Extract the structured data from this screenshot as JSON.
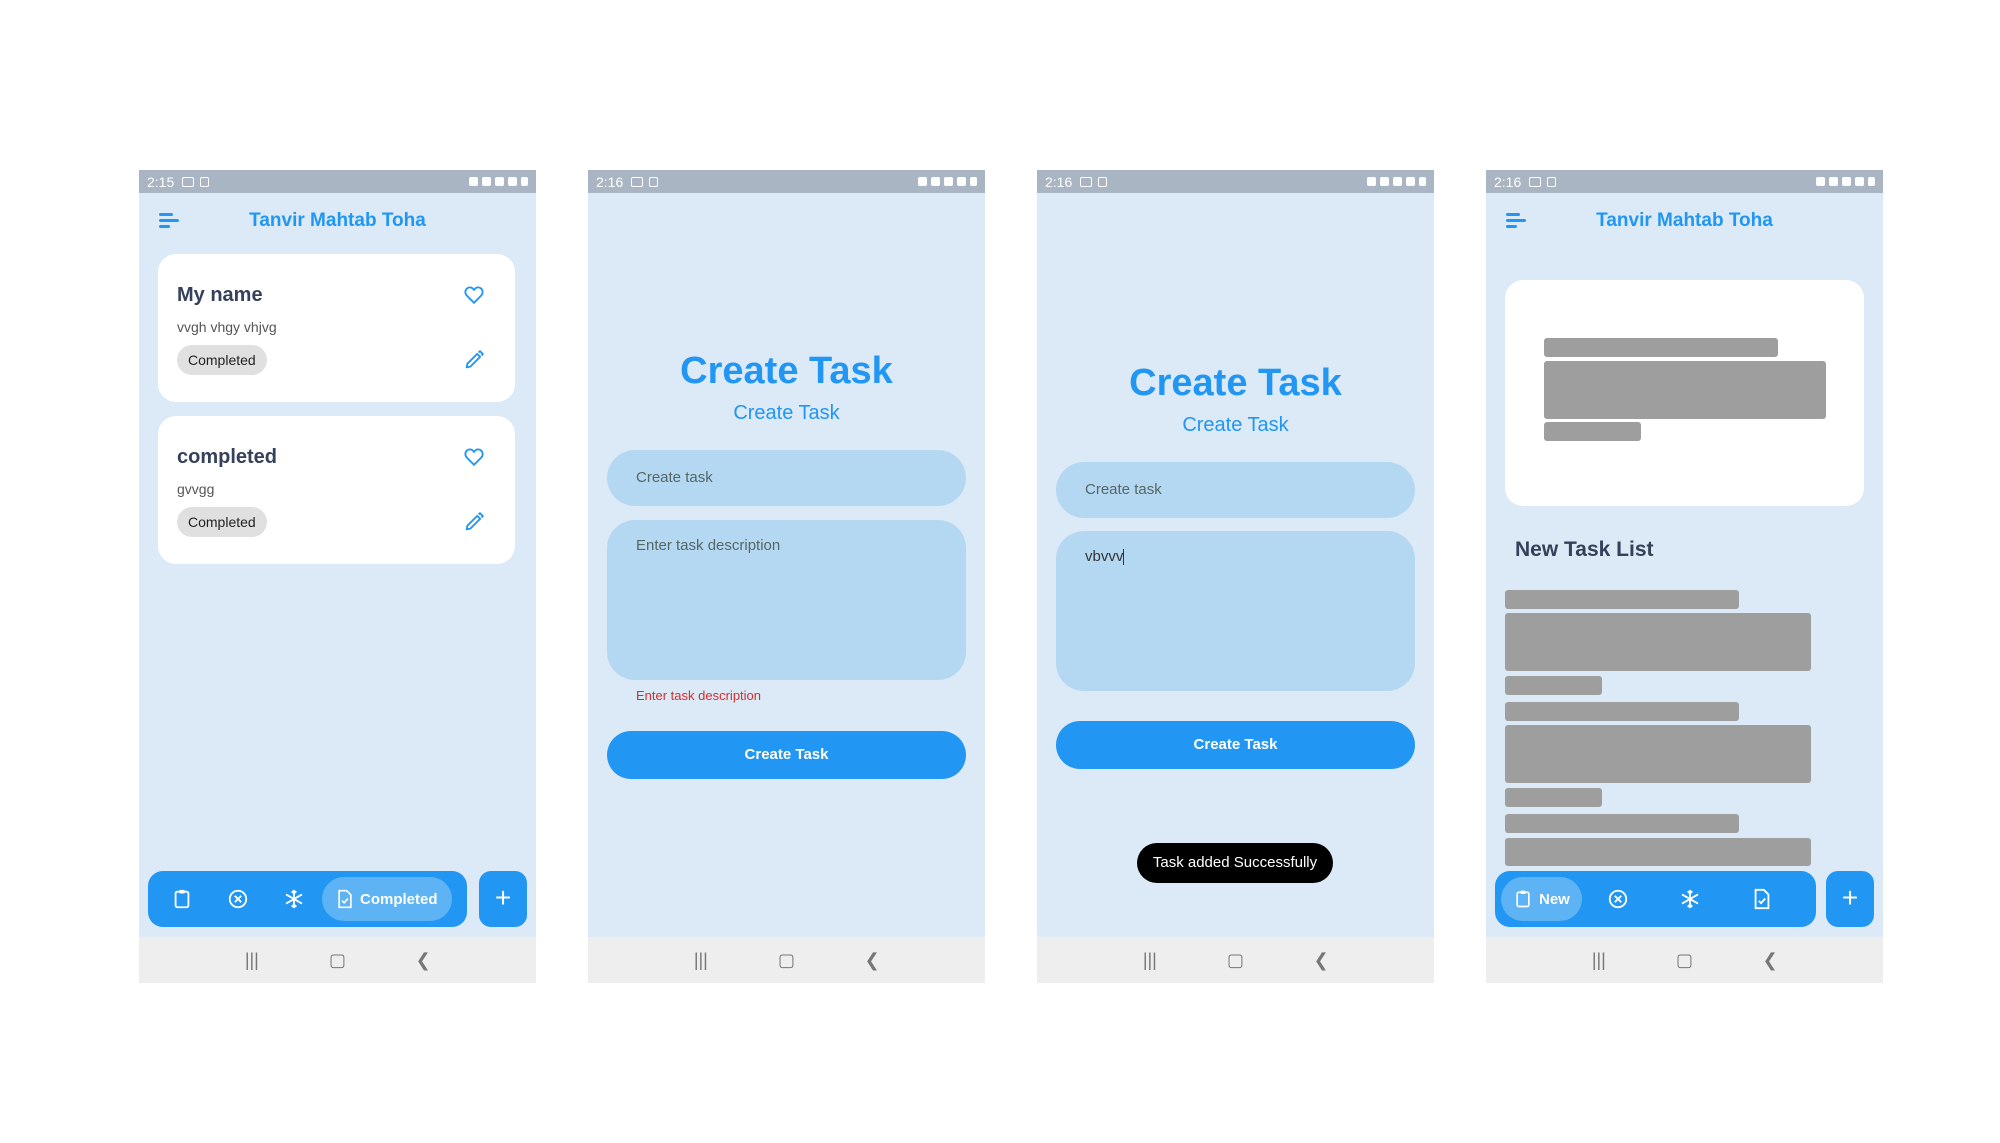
{
  "status": {
    "time_1": "2:15",
    "time_2": "2:16",
    "time_3": "2:16",
    "time_4": "2:16"
  },
  "appbar": {
    "title": "Tanvir Mahtab Toha"
  },
  "screen1": {
    "tasks": [
      {
        "title": "My name",
        "description": "vvgh vhgy vhjvg",
        "status": "Completed"
      },
      {
        "title": "completed",
        "description": "gvvgg",
        "status": "Completed"
      }
    ],
    "bottom_nav": {
      "active_label": "Completed"
    }
  },
  "screen2": {
    "title": "Create Task",
    "subtitle": "Create Task",
    "task_placeholder": "Create task",
    "description_placeholder": "Enter task description",
    "error": "Enter task description",
    "button": "Create Task"
  },
  "screen3": {
    "title": "Create Task",
    "subtitle": "Create Task",
    "task_placeholder": "Create task",
    "description_value": "vbvvv",
    "button": "Create Task",
    "toast": "Task added Successfully"
  },
  "screen4": {
    "section_title": "New Task List",
    "bottom_nav": {
      "active_label": "New"
    }
  },
  "colors": {
    "accent": "#2196f3",
    "background": "#dce9f6",
    "field": "#b5d8f2",
    "error": "#d32f2f"
  },
  "icons": [
    "menu-icon",
    "heart-icon",
    "edit-icon",
    "clipboard-icon",
    "cancel-icon",
    "snowflake-icon",
    "document-check-icon",
    "plus-icon"
  ]
}
